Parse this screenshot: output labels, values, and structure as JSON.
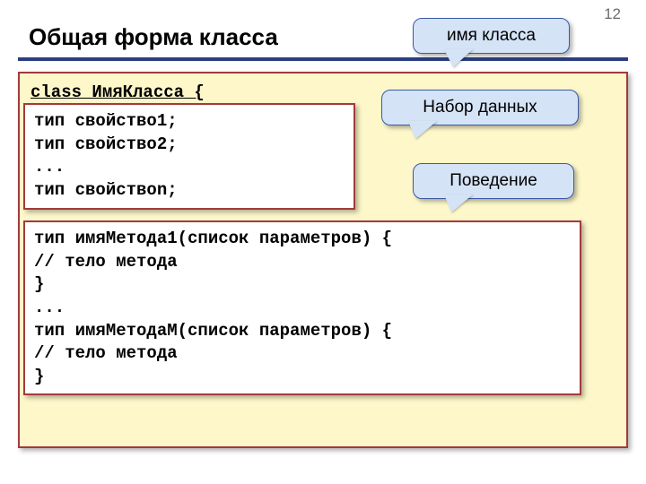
{
  "page_number": "12",
  "title": "Общая форма класса",
  "class_declaration": "class ИмяКласса {",
  "properties_code": "тип свойство1;\nтип свойство2;\n...\nтип свойствоn;",
  "methods_code": "тип имяМетода1(список параметров) {\n// тело метода\n}\n...\nтип имяМетодаМ(список параметров) {\n// тело метода\n}",
  "callouts": {
    "class_name": "имя класса",
    "data_set": "Набор данных",
    "behavior": "Поведение"
  }
}
